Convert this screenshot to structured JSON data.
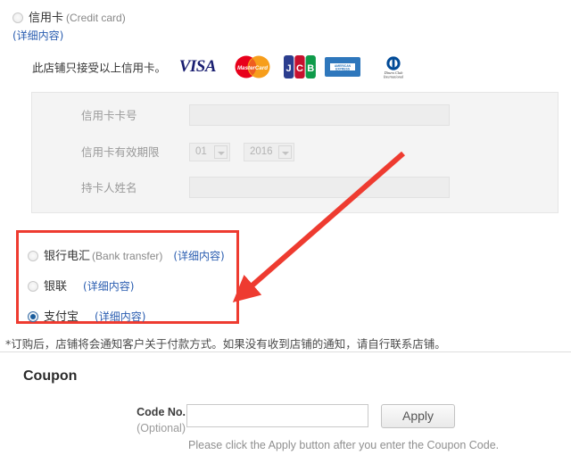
{
  "credit_card_option": {
    "label_cn": "信用卡",
    "label_en": "(Credit card)",
    "detail_link": "(详细内容)",
    "selected": false
  },
  "accepted_cards": {
    "text": "此店铺只接受以上信用卡。",
    "logos": [
      {
        "name": "visa-logo",
        "text": "VISA"
      },
      {
        "name": "mastercard-logo",
        "text": "MasterCard"
      },
      {
        "name": "jcb-logo",
        "text": "JCB"
      },
      {
        "name": "amex-logo",
        "text": "AMERICAN EXPRESS"
      },
      {
        "name": "diners-club-logo",
        "text": "Diners Club International"
      }
    ]
  },
  "credit_card_form": {
    "card_number": {
      "label": "信用卡卡号",
      "value": "",
      "disabled": true
    },
    "expiry": {
      "label": "信用卡有效期限",
      "month": "01",
      "year": "2016",
      "disabled": true
    },
    "holder_name": {
      "label": "持卡人姓名",
      "value": "",
      "disabled": true
    }
  },
  "payment_methods": [
    {
      "label_cn": "银行电汇",
      "label_en": "(Bank transfer)",
      "detail_link": "(详细内容)",
      "selected": false
    },
    {
      "label_cn": "银联",
      "label_en": "",
      "detail_link": "(详细内容)",
      "selected": false
    },
    {
      "label_cn": "支付宝",
      "label_en": "",
      "detail_link": "(详细内容)",
      "selected": true
    }
  ],
  "notice": "*订购后，店铺将会通知客户关于付款方式。如果没有收到店铺的通知，请自行联系店铺。",
  "coupon": {
    "title": "Coupon",
    "label": "Code No.",
    "optional": "(Optional)",
    "input_value": "",
    "apply_label": "Apply",
    "hint": "Please click the Apply button after you enter the Coupon Code."
  },
  "annotation": {
    "highlight_color": "#ee3b30",
    "arrow_color": "#ee3b30"
  }
}
